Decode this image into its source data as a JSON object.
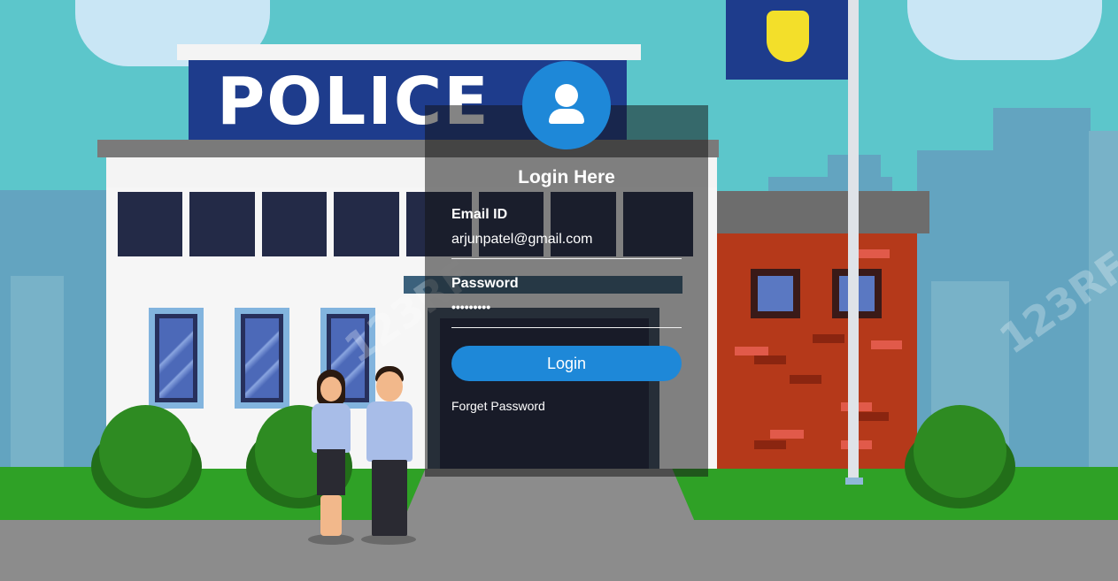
{
  "background": {
    "sign_text": "POLICE",
    "watermark": "123RF"
  },
  "login": {
    "title": "Login Here",
    "email_label": "Email ID",
    "email_value": "arjunpatel@gmail.com",
    "password_label": "Password",
    "password_value": "•••••••••",
    "login_button": "Login",
    "forgot_link": "Forget Password",
    "avatar_icon": "user-icon"
  },
  "colors": {
    "accent": "#1e88d8",
    "panel": "rgba(20,20,20,0.52)",
    "sign": "#1e3c8c"
  }
}
